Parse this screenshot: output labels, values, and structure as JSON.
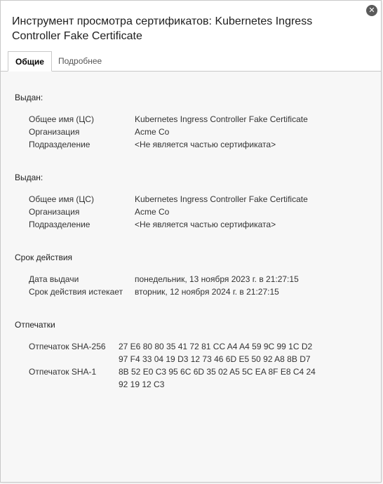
{
  "dialog": {
    "title": "Инструмент просмотра сертификатов: Kubernetes Ingress Controller Fake Certificate",
    "close_icon": "close-icon"
  },
  "tabs": [
    {
      "label": "Общие",
      "active": true
    },
    {
      "label": "Подробнее",
      "active": false
    }
  ],
  "issued_to": {
    "heading": "Выдан:",
    "cn_label": "Общее имя (ЦС)",
    "cn_value": "Kubernetes Ingress Controller Fake Certificate",
    "org_label": "Организация",
    "org_value": "Acme Co",
    "ou_label": "Подразделение",
    "ou_value": "<Не является частью сертификата>"
  },
  "issued_by": {
    "heading": "Выдан:",
    "cn_label": "Общее имя (ЦС)",
    "cn_value": "Kubernetes Ingress Controller Fake Certificate",
    "org_label": "Организация",
    "org_value": "Acme Co",
    "ou_label": "Подразделение",
    "ou_value": "<Не является частью сертификата>"
  },
  "validity": {
    "heading": "Срок действия",
    "issued_label": "Дата выдачи",
    "issued_value": "понедельник, 13 ноября 2023 г. в 21:27:15",
    "expires_label": "Срок действия истекает",
    "expires_value": "вторник, 12 ноября 2024 г. в 21:27:15"
  },
  "fingerprints": {
    "heading": "Отпечатки",
    "sha256_label": "Отпечаток SHA-256",
    "sha256_line1": "27 E6 80 80 35 41 72 81 CC A4 A4 59 9C 99 1C D2",
    "sha256_line2": "97 F4 33 04 19 D3 12 73 46 6D E5 50 92 A8 8B D7",
    "sha1_label": "Отпечаток SHA-1",
    "sha1_line1": "8B 52 E0 C3 95 6C 6D 35 02 A5 5C EA 8F E8 C4 24",
    "sha1_line2": "92 19 12 C3"
  }
}
